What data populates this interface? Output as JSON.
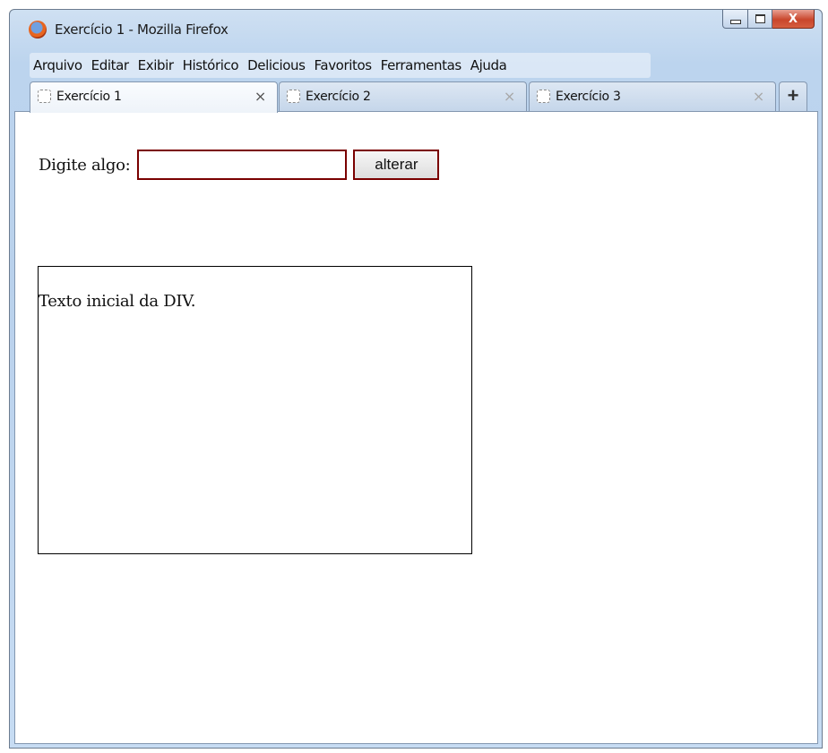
{
  "window": {
    "title": "Exercício 1 - Mozilla Firefox",
    "app_icon": "firefox-icon",
    "controls": {
      "minimize": "minimize-icon",
      "maximize": "maximize-icon",
      "close": "X"
    }
  },
  "menubar": {
    "items": [
      "Arquivo",
      "Editar",
      "Exibir",
      "Histórico",
      "Delicious",
      "Favoritos",
      "Ferramentas",
      "Ajuda"
    ]
  },
  "tabs": [
    {
      "label": "Exercício 1",
      "close": "×",
      "active": true
    },
    {
      "label": "Exercício 2",
      "close": "×",
      "active": false
    },
    {
      "label": "Exercício 3",
      "close": "×",
      "active": false
    }
  ],
  "new_tab": "+",
  "page": {
    "prompt_label": "Digite algo:",
    "input_value": "",
    "button_label": "alterar",
    "div_text": "Texto inicial da DIV."
  },
  "colors": {
    "input_border": "#7a0000",
    "window_frame": "#bcd4ee",
    "close_button": "#c9462c"
  }
}
